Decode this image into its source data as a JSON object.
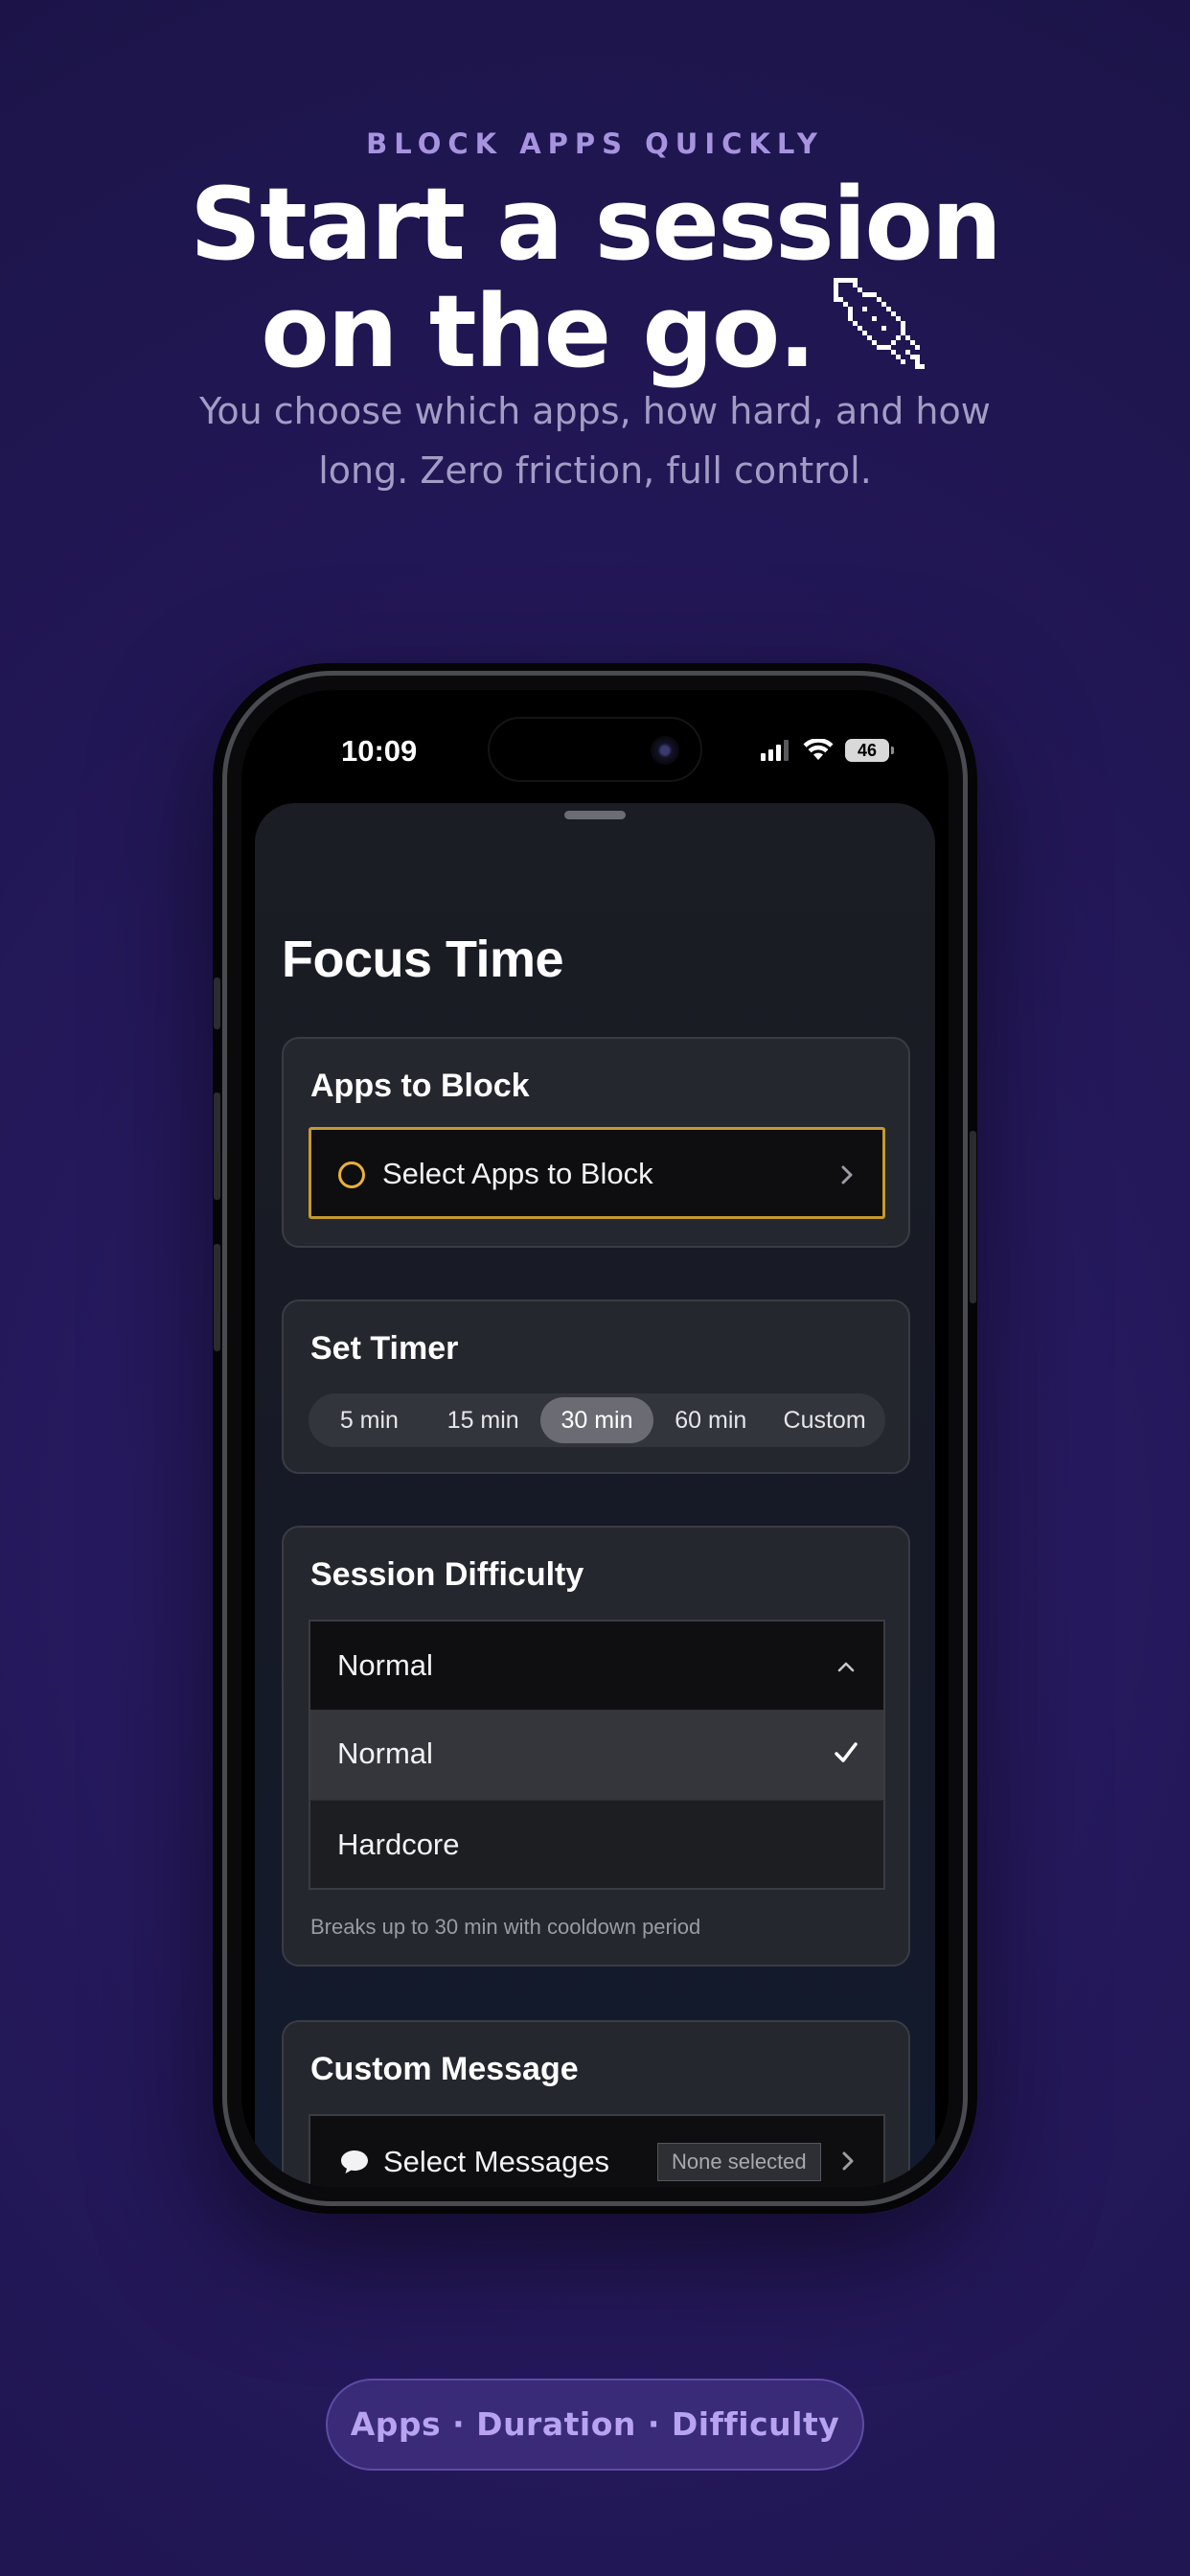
{
  "hero": {
    "eyebrow": "BLOCK APPS QUICKLY",
    "headline_line1": "Start a session",
    "headline_line2": "on the go.",
    "headline_icon": "pixel-rocket-icon",
    "subhead": "You choose which apps, how hard, and how long. Zero friction, full control."
  },
  "statusbar": {
    "time": "10:09",
    "battery": "46",
    "icons": [
      "signal-icon",
      "wifi-icon",
      "battery-icon"
    ]
  },
  "sheet": {
    "title": "Focus Time",
    "apps_card": {
      "title": "Apps to Block",
      "select_label": "Select Apps to Block"
    },
    "timer_card": {
      "title": "Set Timer",
      "options": [
        "5 min",
        "15 min",
        "30 min",
        "60 min",
        "Custom"
      ],
      "selected": "30 min"
    },
    "difficulty_card": {
      "title": "Session Difficulty",
      "selected_value": "Normal",
      "options": [
        "Normal",
        "Hardcore"
      ],
      "hint": "Breaks up to 30 min with cooldown period"
    },
    "message_card": {
      "title": "Custom Message",
      "select_label": "Select Messages",
      "badge": "None selected"
    }
  },
  "footer_pill": "Apps · Duration · Difficulty",
  "colors": {
    "accent_gold": "#c49a2e",
    "eyebrow_purple": "#a793e0",
    "background": "#24185a"
  }
}
